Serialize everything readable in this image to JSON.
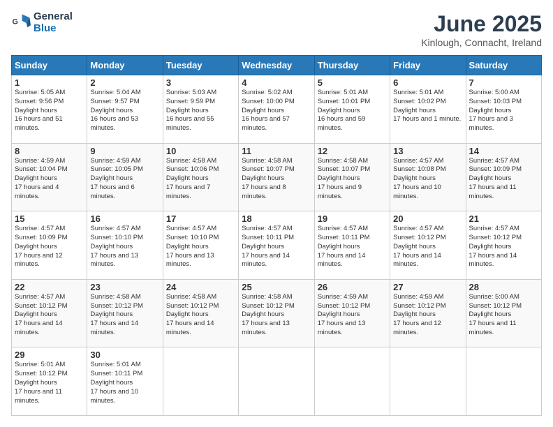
{
  "logo": {
    "line1": "General",
    "line2": "Blue"
  },
  "title": "June 2025",
  "subtitle": "Kinlough, Connacht, Ireland",
  "days_header": [
    "Sunday",
    "Monday",
    "Tuesday",
    "Wednesday",
    "Thursday",
    "Friday",
    "Saturday"
  ],
  "weeks": [
    [
      {
        "num": "1",
        "sr": "5:05 AM",
        "ss": "9:56 PM",
        "dl": "16 hours and 51 minutes."
      },
      {
        "num": "2",
        "sr": "5:04 AM",
        "ss": "9:57 PM",
        "dl": "16 hours and 53 minutes."
      },
      {
        "num": "3",
        "sr": "5:03 AM",
        "ss": "9:59 PM",
        "dl": "16 hours and 55 minutes."
      },
      {
        "num": "4",
        "sr": "5:02 AM",
        "ss": "10:00 PM",
        "dl": "16 hours and 57 minutes."
      },
      {
        "num": "5",
        "sr": "5:01 AM",
        "ss": "10:01 PM",
        "dl": "16 hours and 59 minutes."
      },
      {
        "num": "6",
        "sr": "5:01 AM",
        "ss": "10:02 PM",
        "dl": "17 hours and 1 minute."
      },
      {
        "num": "7",
        "sr": "5:00 AM",
        "ss": "10:03 PM",
        "dl": "17 hours and 3 minutes."
      }
    ],
    [
      {
        "num": "8",
        "sr": "4:59 AM",
        "ss": "10:04 PM",
        "dl": "17 hours and 4 minutes."
      },
      {
        "num": "9",
        "sr": "4:59 AM",
        "ss": "10:05 PM",
        "dl": "17 hours and 6 minutes."
      },
      {
        "num": "10",
        "sr": "4:58 AM",
        "ss": "10:06 PM",
        "dl": "17 hours and 7 minutes."
      },
      {
        "num": "11",
        "sr": "4:58 AM",
        "ss": "10:07 PM",
        "dl": "17 hours and 8 minutes."
      },
      {
        "num": "12",
        "sr": "4:58 AM",
        "ss": "10:07 PM",
        "dl": "17 hours and 9 minutes."
      },
      {
        "num": "13",
        "sr": "4:57 AM",
        "ss": "10:08 PM",
        "dl": "17 hours and 10 minutes."
      },
      {
        "num": "14",
        "sr": "4:57 AM",
        "ss": "10:09 PM",
        "dl": "17 hours and 11 minutes."
      }
    ],
    [
      {
        "num": "15",
        "sr": "4:57 AM",
        "ss": "10:09 PM",
        "dl": "17 hours and 12 minutes."
      },
      {
        "num": "16",
        "sr": "4:57 AM",
        "ss": "10:10 PM",
        "dl": "17 hours and 13 minutes."
      },
      {
        "num": "17",
        "sr": "4:57 AM",
        "ss": "10:10 PM",
        "dl": "17 hours and 13 minutes."
      },
      {
        "num": "18",
        "sr": "4:57 AM",
        "ss": "10:11 PM",
        "dl": "17 hours and 14 minutes."
      },
      {
        "num": "19",
        "sr": "4:57 AM",
        "ss": "10:11 PM",
        "dl": "17 hours and 14 minutes."
      },
      {
        "num": "20",
        "sr": "4:57 AM",
        "ss": "10:12 PM",
        "dl": "17 hours and 14 minutes."
      },
      {
        "num": "21",
        "sr": "4:57 AM",
        "ss": "10:12 PM",
        "dl": "17 hours and 14 minutes."
      }
    ],
    [
      {
        "num": "22",
        "sr": "4:57 AM",
        "ss": "10:12 PM",
        "dl": "17 hours and 14 minutes."
      },
      {
        "num": "23",
        "sr": "4:58 AM",
        "ss": "10:12 PM",
        "dl": "17 hours and 14 minutes."
      },
      {
        "num": "24",
        "sr": "4:58 AM",
        "ss": "10:12 PM",
        "dl": "17 hours and 14 minutes."
      },
      {
        "num": "25",
        "sr": "4:58 AM",
        "ss": "10:12 PM",
        "dl": "17 hours and 13 minutes."
      },
      {
        "num": "26",
        "sr": "4:59 AM",
        "ss": "10:12 PM",
        "dl": "17 hours and 13 minutes."
      },
      {
        "num": "27",
        "sr": "4:59 AM",
        "ss": "10:12 PM",
        "dl": "17 hours and 12 minutes."
      },
      {
        "num": "28",
        "sr": "5:00 AM",
        "ss": "10:12 PM",
        "dl": "17 hours and 11 minutes."
      }
    ],
    [
      {
        "num": "29",
        "sr": "5:01 AM",
        "ss": "10:12 PM",
        "dl": "17 hours and 11 minutes."
      },
      {
        "num": "30",
        "sr": "5:01 AM",
        "ss": "10:11 PM",
        "dl": "17 hours and 10 minutes."
      },
      null,
      null,
      null,
      null,
      null
    ]
  ]
}
